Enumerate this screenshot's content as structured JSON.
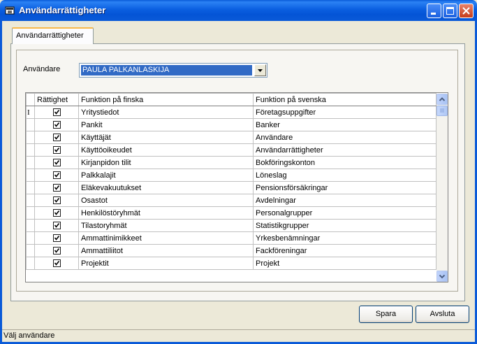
{
  "window": {
    "title": "Användarrättigheter"
  },
  "tab": {
    "label": "Användarrättigheter"
  },
  "user": {
    "label": "Användare",
    "selected": "PAULA PALKANLASKIJA"
  },
  "grid": {
    "columns": {
      "check": "Rättighet",
      "fi": "Funktion på finska",
      "sv": "Funktion på svenska"
    },
    "row_marker": "I",
    "rows": [
      {
        "checked": true,
        "fi": "Yritystiedot",
        "sv": "Företagsuppgifter"
      },
      {
        "checked": true,
        "fi": "Pankit",
        "sv": "Banker"
      },
      {
        "checked": true,
        "fi": "Käyttäjät",
        "sv": "Användare"
      },
      {
        "checked": true,
        "fi": "Käyttöoikeudet",
        "sv": "Användarrättigheter"
      },
      {
        "checked": true,
        "fi": "Kirjanpidon tilit",
        "sv": "Bokföringskonton"
      },
      {
        "checked": true,
        "fi": "Palkkalajit",
        "sv": "Löneslag"
      },
      {
        "checked": true,
        "fi": "Eläkevakuutukset",
        "sv": "Pensionsförsäkringar"
      },
      {
        "checked": true,
        "fi": "Osastot",
        "sv": "Avdelningar"
      },
      {
        "checked": true,
        "fi": "Henkilöstöryhmät",
        "sv": "Personalgrupper"
      },
      {
        "checked": true,
        "fi": "Tilastoryhmät",
        "sv": "Statistikgrupper"
      },
      {
        "checked": true,
        "fi": "Ammattinimikkeet",
        "sv": "Yrkesbenämningar"
      },
      {
        "checked": true,
        "fi": "Ammattiliitot",
        "sv": "Fackföreningar"
      },
      {
        "checked": true,
        "fi": "Projektit",
        "sv": "Projekt"
      }
    ]
  },
  "buttons": {
    "save": "Spara",
    "exit": "Avsluta"
  },
  "status": {
    "text": "Välj användare"
  }
}
